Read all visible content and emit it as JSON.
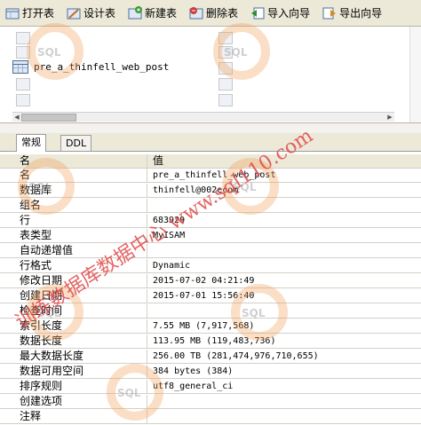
{
  "toolbar": {
    "buttons": [
      {
        "label": "打开表",
        "icon": "open-table-icon"
      },
      {
        "label": "设计表",
        "icon": "design-table-icon"
      },
      {
        "label": "新建表",
        "icon": "new-table-icon"
      },
      {
        "label": "删除表",
        "icon": "delete-table-icon"
      },
      {
        "label": "导入向导",
        "icon": "import-wizard-icon"
      },
      {
        "label": "导出向导",
        "icon": "export-wizard-icon"
      }
    ]
  },
  "object_list": {
    "selected_item": "pre_a_thinfell_web_post"
  },
  "tabs": [
    {
      "label": "常规"
    },
    {
      "label": "DDL"
    }
  ],
  "properties": {
    "header": {
      "name": "名",
      "value": "值"
    },
    "rows": [
      {
        "name": "名",
        "value": "pre_a_thinfell_web_post"
      },
      {
        "name": "数据库",
        "value": "thinfell@002ecom"
      },
      {
        "name": "组名",
        "value": ""
      },
      {
        "name": "行",
        "value": "683929"
      },
      {
        "name": "表类型",
        "value": "MyISAM"
      },
      {
        "name": "自动递增值",
        "value": ""
      },
      {
        "name": "行格式",
        "value": "Dynamic"
      },
      {
        "name": "修改日期",
        "value": "2015-07-02 04:21:49"
      },
      {
        "name": "创建日期",
        "value": "2015-07-01 15:56:40"
      },
      {
        "name": "检查时间",
        "value": ""
      },
      {
        "name": "索引长度",
        "value": "7.55 MB (7,917,568)"
      },
      {
        "name": "数据长度",
        "value": "113.95 MB (119,483,736)"
      },
      {
        "name": "最大数据长度",
        "value": "256.00 TB (281,474,976,710,655)"
      },
      {
        "name": "数据可用空间",
        "value": "384 bytes (384)"
      },
      {
        "name": "排序规则",
        "value": "utf8_general_ci"
      },
      {
        "name": "创建选项",
        "value": ""
      },
      {
        "name": "注释",
        "value": ""
      }
    ]
  },
  "watermark": {
    "text": "训练数据库数据中心 www.sql110.com",
    "logo_text": "SQL"
  }
}
